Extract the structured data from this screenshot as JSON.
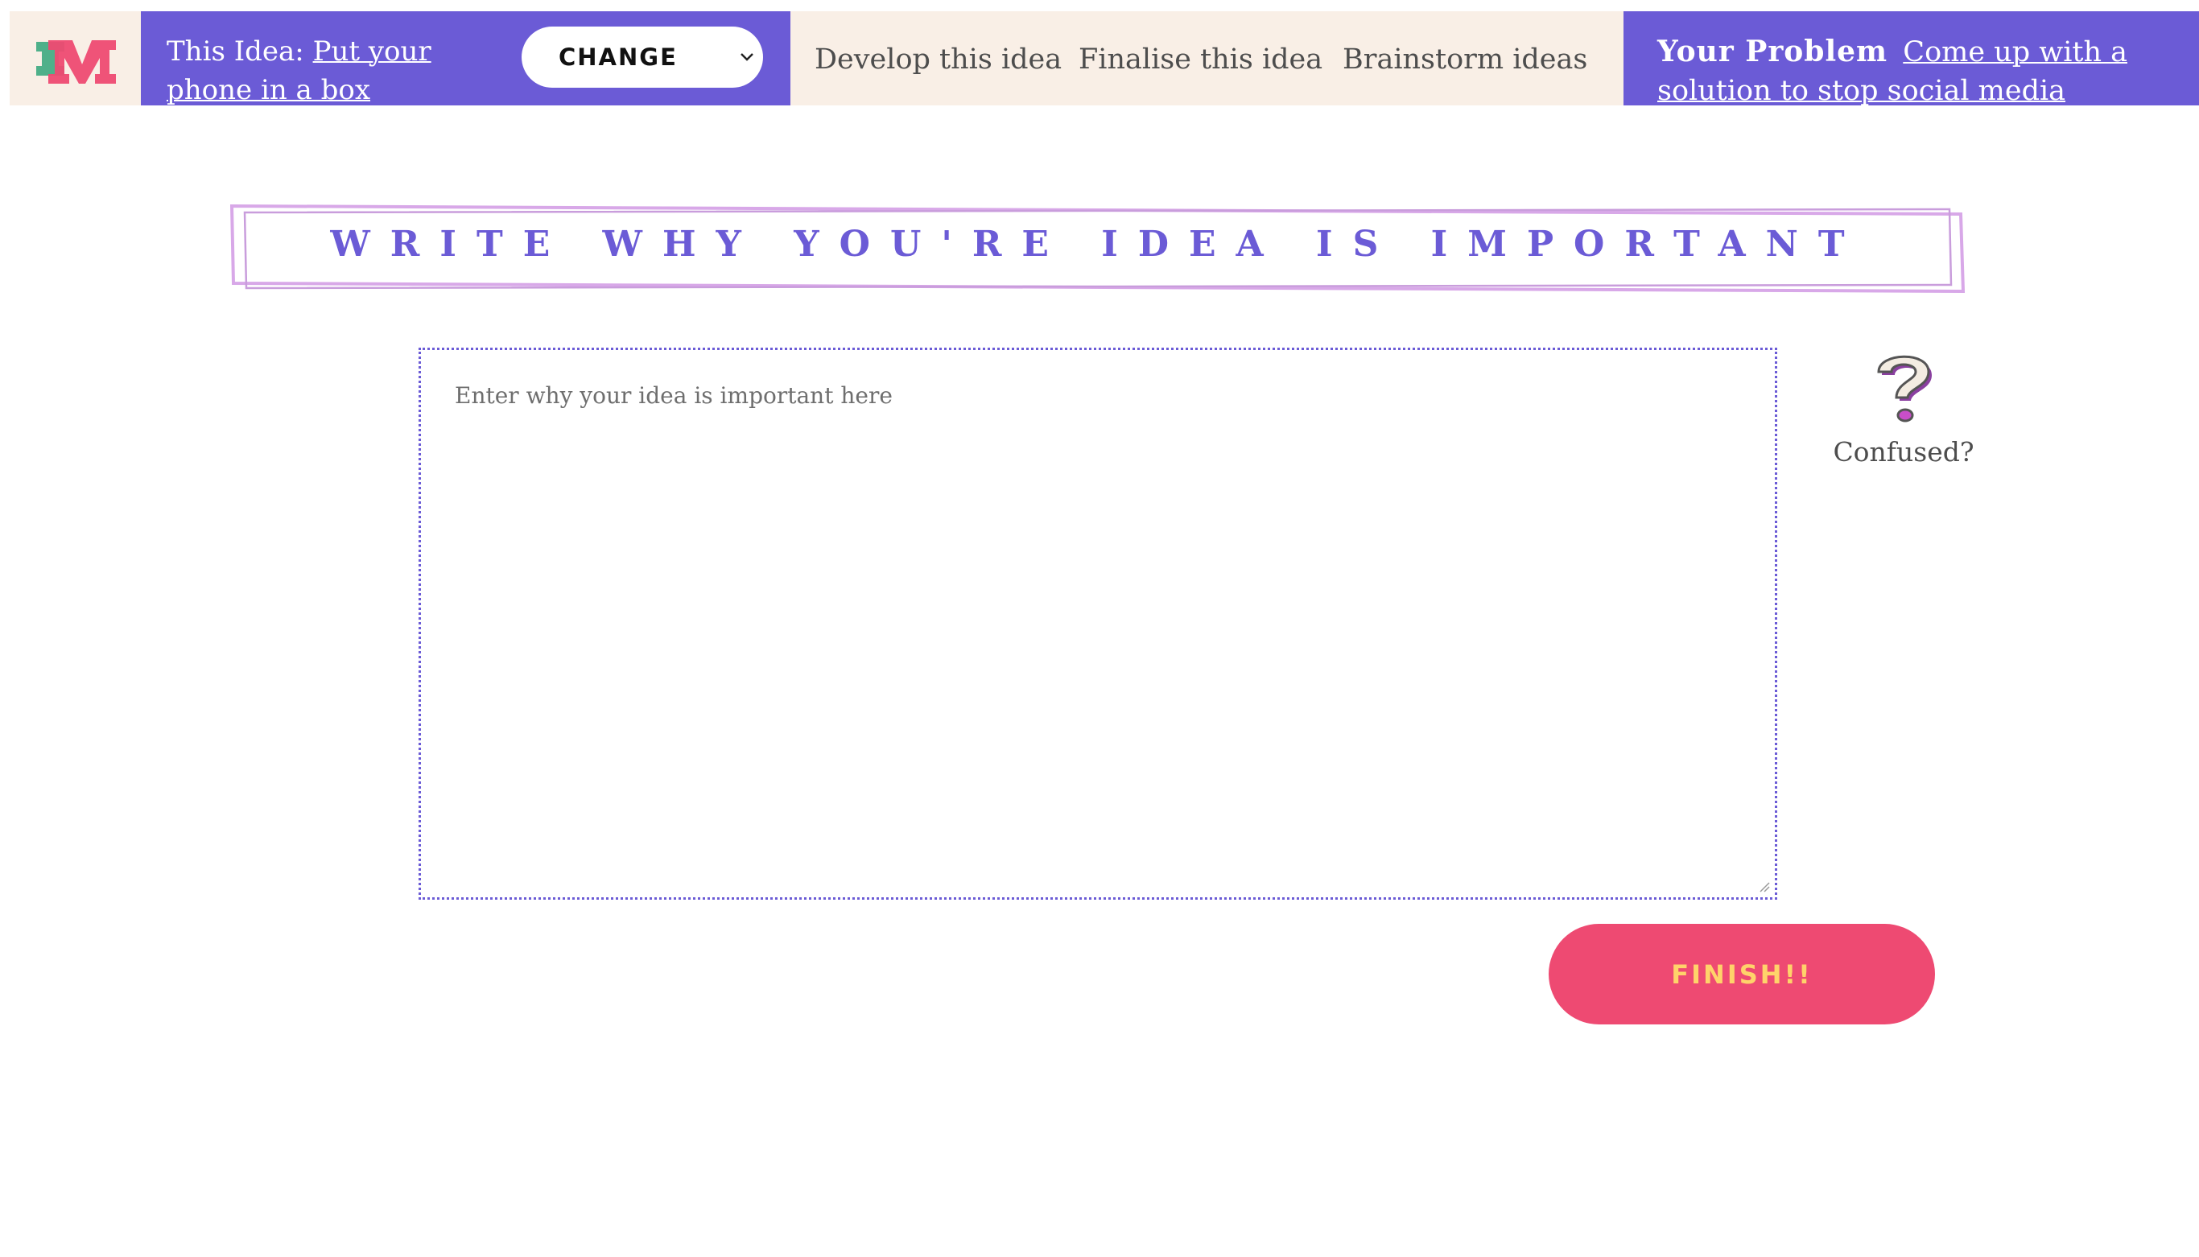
{
  "header": {
    "idea_prefix": "This Idea:",
    "idea_value": "Put your phone in a box",
    "change_label": "CHANGE",
    "links": [
      "Develop this idea",
      "Finalise this idea",
      "Brainstorm ideas"
    ],
    "problem_label": "Your Problem",
    "problem_text": "Come up with a solution to stop social media addiction"
  },
  "main": {
    "title": "Write why you're idea is important",
    "textarea_placeholder": "Enter why your idea is important here",
    "help_label": "Confused?",
    "finish_label": "FINISH!!"
  },
  "colors": {
    "accent": "#6b5bd6",
    "nav_bg": "#f9efe6",
    "finish_bg": "#ee4a72",
    "finish_text": "#ffd36a",
    "logo_pink": "#ee4a72",
    "logo_green": "#4fb08a"
  },
  "icons": {
    "logo": "im-logo",
    "help": "question-mark-icon",
    "dropdown": "chevron-down-icon"
  }
}
